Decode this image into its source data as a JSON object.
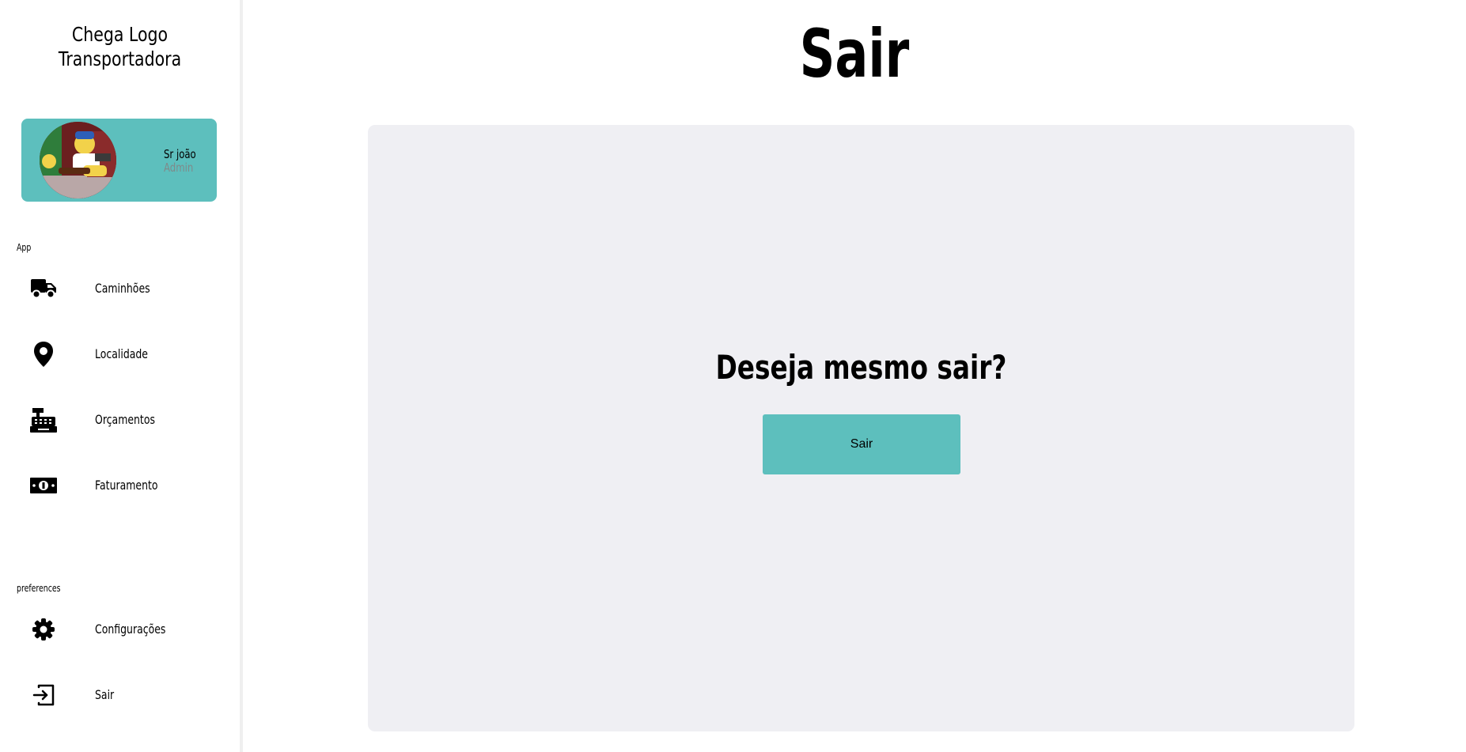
{
  "brand": {
    "line1": "Chega Logo",
    "line2": "Transportadora"
  },
  "profile": {
    "name": "Sr joão",
    "role": "Admin",
    "avatar_icon": "avatar-cartoon"
  },
  "sidebar": {
    "app_section_label": "App",
    "app_items": [
      {
        "label": "Caminhões",
        "icon": "truck-icon"
      },
      {
        "label": "Localidade",
        "icon": "map-pin-icon"
      },
      {
        "label": "Orçamentos",
        "icon": "cash-register-icon"
      },
      {
        "label": "Faturamento",
        "icon": "money-bill-icon"
      }
    ],
    "preferences_section_label": "preferences",
    "preference_items": [
      {
        "label": "Configurações",
        "icon": "gear-icon"
      },
      {
        "label": "Sair",
        "icon": "sign-out-icon"
      }
    ]
  },
  "main": {
    "title": "Sair",
    "question": "Deseja mesmo sair?",
    "confirm_button_label": "Sair"
  },
  "colors": {
    "accent": "#5dbfbd",
    "panel_background": "#efeff3",
    "sidebar_divider": "#efefef"
  }
}
